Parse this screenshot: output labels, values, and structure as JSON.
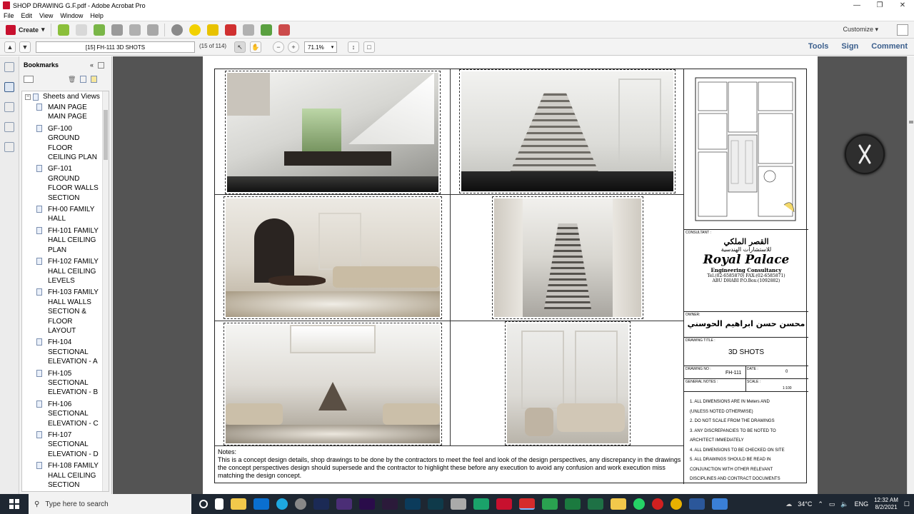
{
  "window": {
    "title": "SHOP DRAWING G.F.pdf - Adobe Acrobat Pro"
  },
  "menu": [
    "File",
    "Edit",
    "View",
    "Window",
    "Help"
  ],
  "toolbar": {
    "create_label": "Create",
    "customize_label": "Customize"
  },
  "nav": {
    "page_field": "[15] FH-111 3D SHOTS",
    "page_count": "(15 of 114)",
    "zoom": "71.1%"
  },
  "right_links": {
    "tools": "Tools",
    "sign": "Sign",
    "comment": "Comment"
  },
  "bookmarks": {
    "title": "Bookmarks",
    "root": "Sheets and Views",
    "items": [
      "MAIN PAGE MAIN PAGE",
      "GF-100 GROUND FLOOR CEILING PLAN",
      "GF-101 GROUND FLOOR WALLS SECTION",
      "FH-00 FAMILY HALL",
      "FH-101 FAMILY HALL CEILING PLAN",
      "FH-102 FAMILY HALL CEILING LEVELS",
      "FH-103 FAMILY HALL WALLS SECTION & FLOOR LAYOUT",
      "FH-104 SECTIONAL ELEVATION - A",
      "FH-105 SECTIONAL ELEVATION - B",
      "FH-106 SECTIONAL ELEVATION - C",
      "FH-107 SECTIONAL ELEVATION - D",
      "FH-108 FAMILY HALL CEILING SECTION"
    ]
  },
  "sheet": {
    "consultant_label": "CONSULTANT :",
    "logo_arabic_1": "القصر الملكي",
    "logo_arabic_2": "للاستشارات الهندسية",
    "logo_name": "Royal Palace",
    "logo_sub": "Engineering Consultancy",
    "logo_contact": "Tel.(02-6585870) FAX:(02-6585871)",
    "logo_address": "ABU DHABI   P.O.Box:(1092882)",
    "owner_label": "OWNER:",
    "owner_name": "محسن حسن ابراهيم الحوسني",
    "title_label": "DRAWING TITLE :",
    "drawing_title": "3D SHOTS",
    "drawing_no_label": "DRAWING NO :",
    "drawing_no": "FH-111",
    "date_label": "DATE :",
    "date_value": "0",
    "general_notes_label": "GENERAL NOTES :",
    "scale_label": "SCALE :",
    "scale_value": "1:100",
    "general_notes": [
      "1.  ALL DIMENSIONS ARE IN Meters AND",
      "      (UNLESS NOTED OTHERWISE)",
      "2.  DO NOT SCALE FROM THE DRAWINGS",
      "3.  ANY DISCREPANCIES TO BE NOTED TO",
      "ARCHITECT IMMEDIATELY",
      "4.  ALL DIMENSIONS TO BE CHECKED ON SITE",
      "5.  ALL DRAWINGS SHOULD BE READ IN",
      "CONJUNCTION WITH OTHER RELEVANT",
      "DISCIPLINES AND CONTRACT DOCUMENTS"
    ],
    "notes_heading": "Notes:",
    "notes_text": "This is a concept design details, shop drawings to be done by the contractors to meet the feel and look of the design perspectives, any discrepancy in the drawings the concept perspectives design should supersede and the contractor to highlight these before any execution to avoid any confusion and work execution miss matching the design concept."
  },
  "taskbar": {
    "search_placeholder": "Type here to search",
    "temperature": "34°C",
    "language": "ENG",
    "time": "12:32 AM",
    "date": "8/2/2021"
  },
  "colors": {
    "acrobat_red": "#c8102e",
    "link_blue": "#3a5e8c",
    "taskbar_bg": "#1e2732",
    "doc_bg": "#545454"
  }
}
